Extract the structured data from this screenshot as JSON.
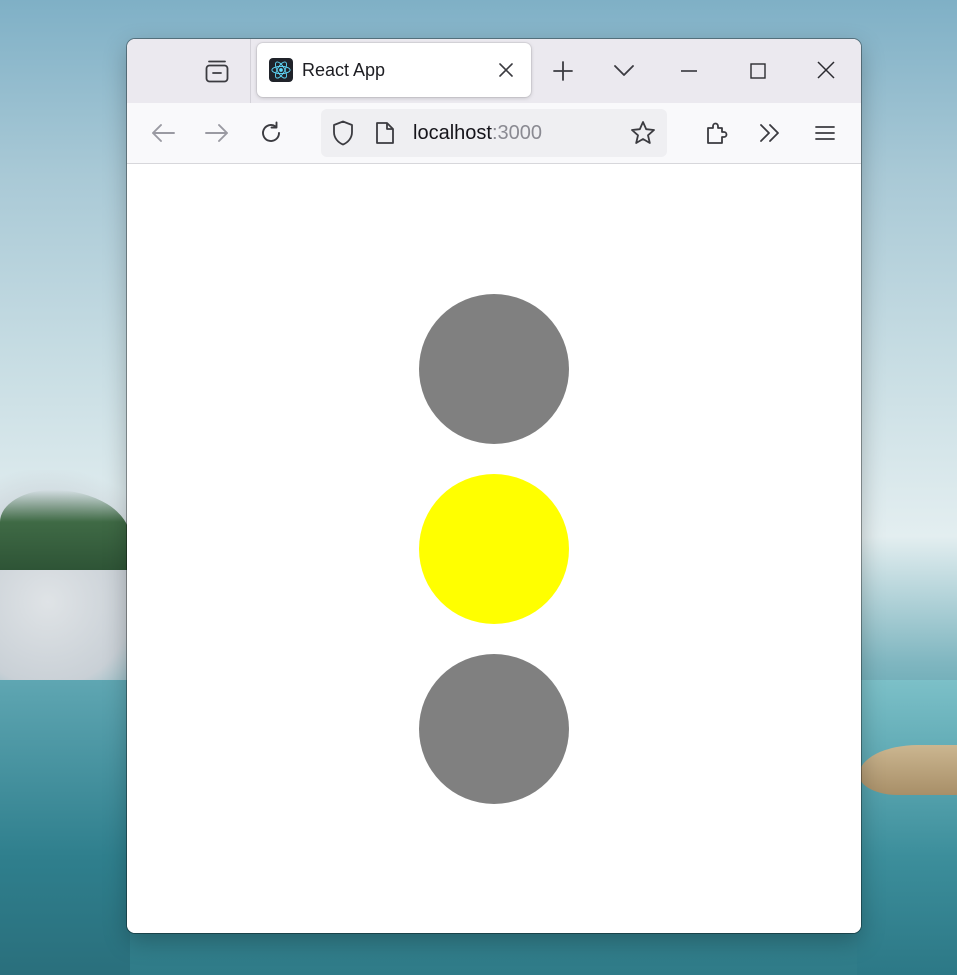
{
  "browser": {
    "tab": {
      "title": "React App",
      "favicon": "react-logo-icon"
    },
    "url": {
      "host": "localhost",
      "port": ":3000"
    },
    "toolbar_icons": [
      "back-arrow-icon",
      "forward-arrow-icon",
      "reload-icon",
      "shield-icon",
      "page-icon",
      "bookmark-star-icon",
      "extensions-icon",
      "overflow-chevrons-icon",
      "menu-icon"
    ],
    "window_controls": [
      "minimize-icon",
      "maximize-icon",
      "close-icon"
    ]
  },
  "traffic_light": {
    "lights": [
      {
        "name": "top",
        "color": "#808080"
      },
      {
        "name": "middle",
        "color": "#ffff00"
      },
      {
        "name": "bottom",
        "color": "#808080"
      }
    ]
  }
}
